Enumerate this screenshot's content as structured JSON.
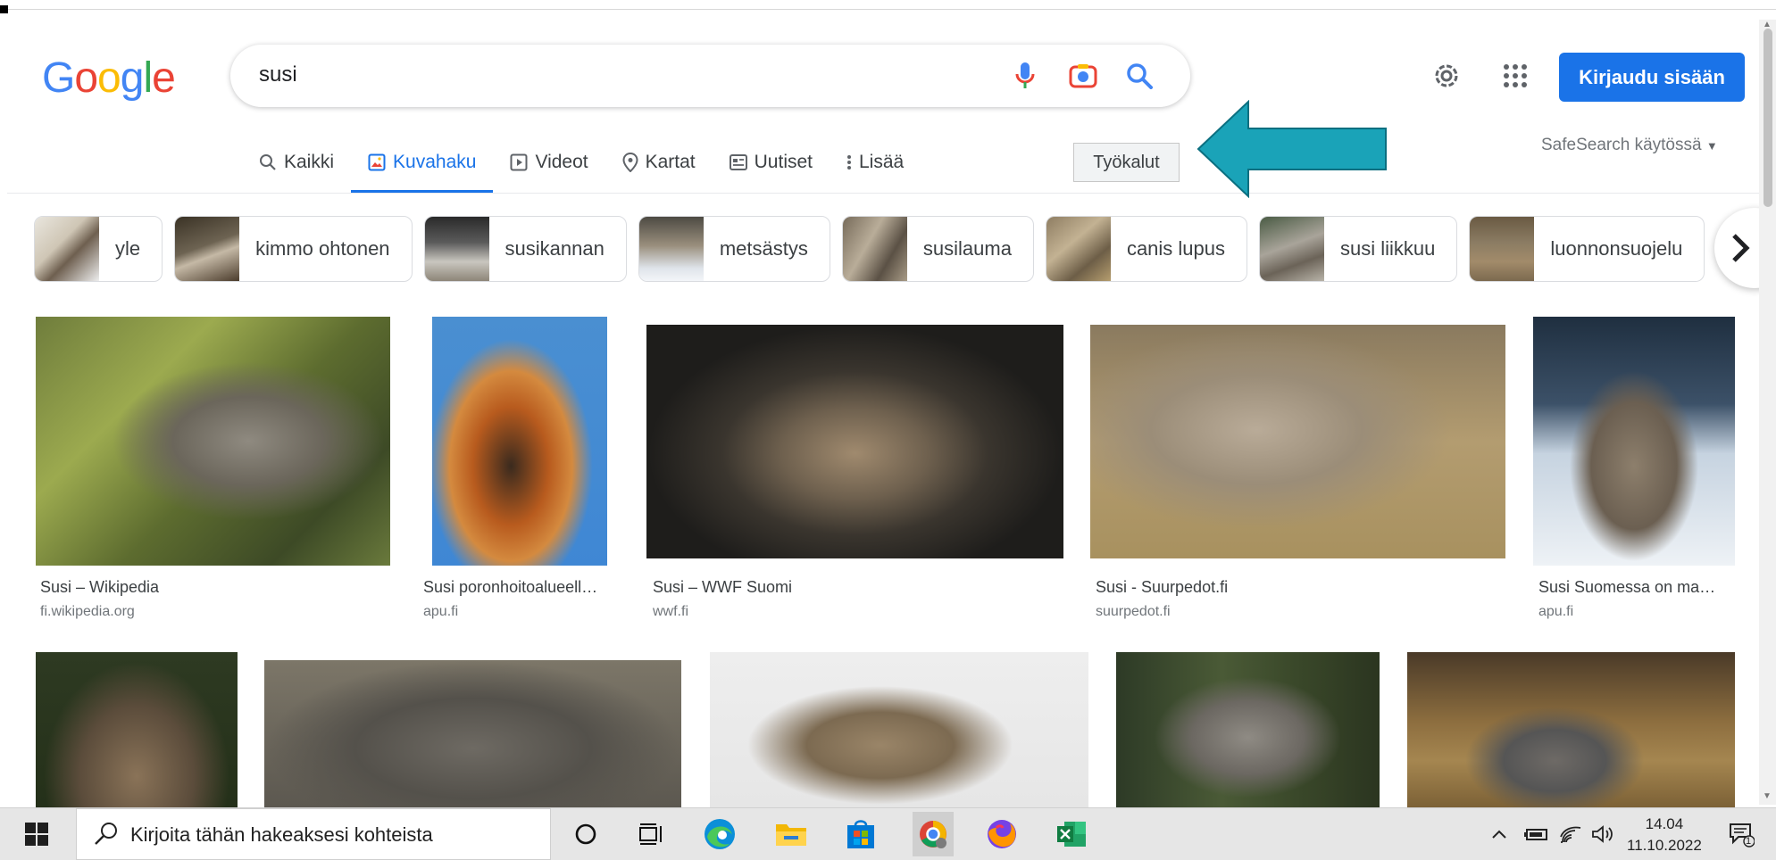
{
  "logo": {
    "letters": [
      "G",
      "o",
      "o",
      "g",
      "l",
      "e"
    ],
    "colors": [
      "#4285f4",
      "#ea4335",
      "#fbbc05",
      "#4285f4",
      "#34a853",
      "#ea4335"
    ]
  },
  "search": {
    "query": "susi"
  },
  "header": {
    "signin_label": "Kirjaudu sisään",
    "safesearch": "SafeSearch käytössä"
  },
  "tabs": [
    {
      "label": "Kaikki",
      "icon": "search-icon",
      "active": false
    },
    {
      "label": "Kuvahaku",
      "icon": "image-icon",
      "active": true
    },
    {
      "label": "Videot",
      "icon": "play-icon",
      "active": false
    },
    {
      "label": "Kartat",
      "icon": "map-pin-icon",
      "active": false
    },
    {
      "label": "Uutiset",
      "icon": "news-icon",
      "active": false
    },
    {
      "label": "Lisää",
      "icon": "more-vert-icon",
      "active": false
    }
  ],
  "tools_label": "Työkalut",
  "chips": [
    "yle",
    "kimmo ohtonen",
    "susikannan",
    "metsästys",
    "susilauma",
    "canis lupus",
    "susi liikkuu",
    "luonnonsuojelu"
  ],
  "results_row1": [
    {
      "title": "Susi – Wikipedia",
      "source": "fi.wikipedia.org"
    },
    {
      "title": "Susi poronhoitoalueell…",
      "source": "apu.fi"
    },
    {
      "title": "Susi – WWF Suomi",
      "source": "wwf.fi"
    },
    {
      "title": "Susi - Suurpedot.fi",
      "source": "suurpedot.fi"
    },
    {
      "title": "Susi Suomessa on ma…",
      "source": "apu.fi"
    }
  ],
  "taskbar": {
    "search_placeholder": "Kirjoita tähän hakeaksesi kohteista",
    "time": "14.04",
    "date": "11.10.2022",
    "notification_count": "1"
  },
  "colors": {
    "accent": "#1a73e8",
    "arrow": "#1aa3b8"
  }
}
